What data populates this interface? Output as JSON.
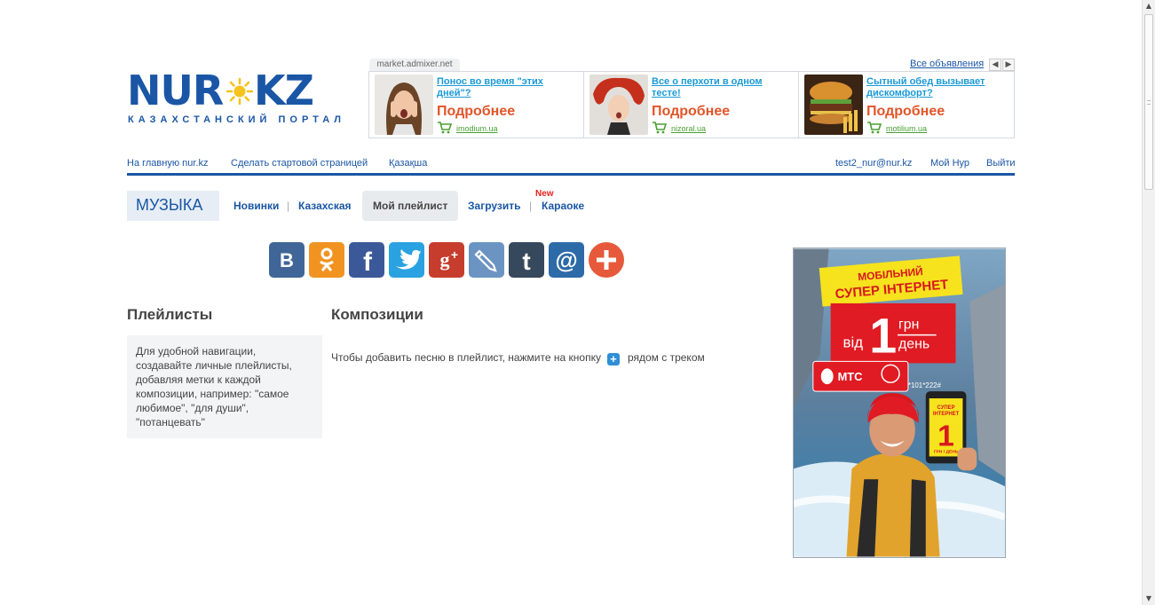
{
  "logo": {
    "part1": "NUR",
    "part2": "KZ",
    "tagline": "КАЗАХСТАНСКИЙ ПОРТАЛ"
  },
  "ads": {
    "source": "market.admixer.net",
    "all_label": "Все объявления",
    "items": [
      {
        "title": "Понос во время \"этих дней\"?",
        "more": "Подробнее",
        "domain": "imodium.ua"
      },
      {
        "title": "Все о перхоти в одном тесте!",
        "more": "Подробнее",
        "domain": "nizoral.ua"
      },
      {
        "title": "Сытный обед вызывает дискомфорт?",
        "more": "Подробнее",
        "domain": "motilium.ua"
      }
    ]
  },
  "topnav": {
    "home": "На главную nur.kz",
    "start_page": "Сделать стартовой страницей",
    "kazakh": "Қазақша",
    "user_email": "test2_nur@nur.kz",
    "my_nur": "Мой Нур",
    "logout": "Выйти"
  },
  "section": {
    "title": "МУЗЫКА",
    "tabs": [
      "Новинки",
      "Казахская",
      "Мой плейлист",
      "Загрузить",
      "Караоке"
    ],
    "separator": "|",
    "new_badge": "New"
  },
  "share": {
    "buttons": [
      {
        "name": "vk",
        "glyph": "B",
        "color": "#3f6696"
      },
      {
        "name": "odnoklassniki",
        "glyph": "ok",
        "color": "#f19321"
      },
      {
        "name": "facebook",
        "glyph": "f",
        "color": "#3b5998"
      },
      {
        "name": "twitter",
        "glyph": "t",
        "color": "#2aa2e1"
      },
      {
        "name": "google-plus",
        "glyph": "g+",
        "color": "#c63d2d"
      },
      {
        "name": "livejournal",
        "glyph": "pencil",
        "color": "#6b94c2"
      },
      {
        "name": "tumblr",
        "glyph": "t",
        "color": "#36485c"
      },
      {
        "name": "mailru",
        "glyph": "@",
        "color": "#2d6aa8"
      },
      {
        "name": "more",
        "glyph": "+",
        "color": "#e6593a"
      }
    ]
  },
  "main": {
    "playlists_heading": "Плейлисты",
    "playlists_info": "Для удобной навигации, создавайте личные плейлисты, добавляя метки к каждой композиции, например: \"самое любимое\", \"для души\", \"потанцевать\"",
    "compositions_heading": "Композиции",
    "hint_before": "Чтобы добавить песню в плейлист, нажмите на кнопку",
    "hint_plus": "+",
    "hint_after": "рядом с треком"
  },
  "banner": {
    "line1": "МОБІЛЬНИЙ",
    "line2": "СУПЕР ІНТЕРНЕТ",
    "from": "від",
    "price": "1",
    "unit1": "грн",
    "unit2": "день",
    "brand": "МТС",
    "code": "*101*222#",
    "phone_line1": "СУПЕР",
    "phone_line2": "ІНТЕРНЕТ",
    "phone_price": "1",
    "phone_unit": "ГРН / ДЕНЬ"
  }
}
